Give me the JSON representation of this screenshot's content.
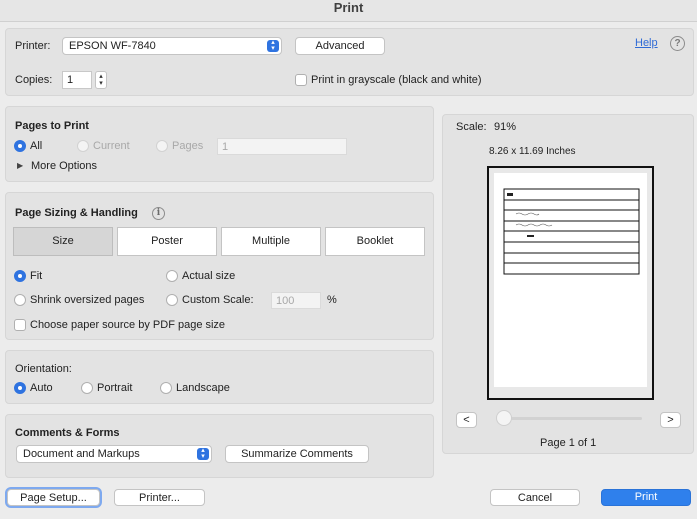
{
  "window": {
    "title": "Print"
  },
  "printer": {
    "label": "Printer:",
    "value": "EPSON WF-7840",
    "advanced_label": "Advanced",
    "help_label": "Help",
    "copies_label": "Copies:",
    "copies_value": "1",
    "grayscale_label": "Print in grayscale (black and white)"
  },
  "pages_to_print": {
    "title": "Pages to Print",
    "all": "All",
    "current": "Current",
    "pages": "Pages",
    "pages_value": "1",
    "more_options": "More Options"
  },
  "sizing": {
    "title": "Page Sizing & Handling",
    "tabs": [
      "Size",
      "Poster",
      "Multiple",
      "Booklet"
    ],
    "fit": "Fit",
    "actual_size": "Actual size",
    "shrink": "Shrink oversized pages",
    "custom_scale": "Custom Scale:",
    "custom_scale_value": "100",
    "percent": "%",
    "paper_source": "Choose paper source by PDF page size"
  },
  "orientation": {
    "title": "Orientation:",
    "auto": "Auto",
    "portrait": "Portrait",
    "landscape": "Landscape"
  },
  "comments": {
    "title": "Comments & Forms",
    "value": "Document and Markups",
    "summarize_label": "Summarize Comments"
  },
  "preview": {
    "scale_label": "Scale:",
    "scale_value": "91%",
    "dimensions": "8.26 x 11.69 Inches",
    "prev": "<",
    "next": ">",
    "page_indicator": "Page 1 of 1"
  },
  "footer": {
    "page_setup": "Page Setup...",
    "printer": "Printer...",
    "cancel": "Cancel",
    "print": "Print"
  },
  "colors": {
    "accent": "#2f73e0",
    "primary_button": "#2f80ec"
  }
}
